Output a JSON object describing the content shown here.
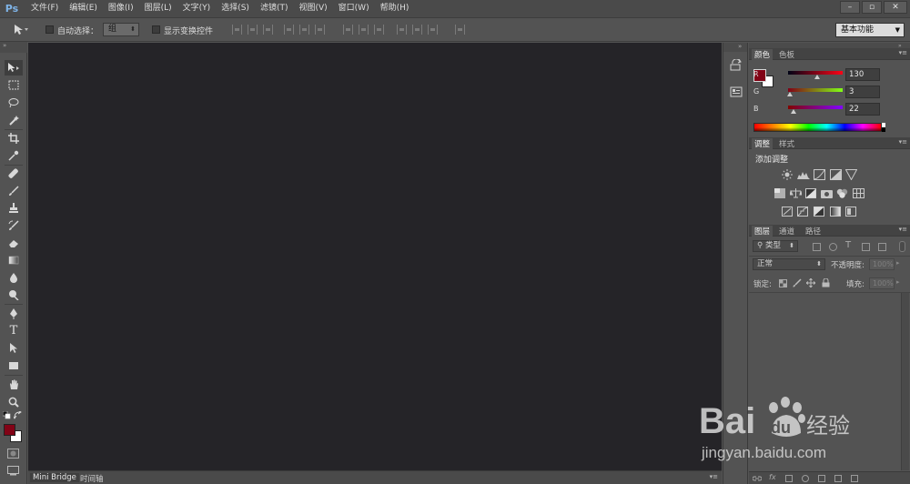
{
  "app": {
    "logo_text": "Ps",
    "menu": [
      "文件(F)",
      "编辑(E)",
      "图像(I)",
      "图层(L)",
      "文字(Y)",
      "选择(S)",
      "滤镜(T)",
      "视图(V)",
      "窗口(W)",
      "帮助(H)"
    ],
    "window_controls": [
      "–",
      "▫",
      "✕"
    ]
  },
  "options_bar": {
    "auto_select_label": "自动选择：",
    "auto_select_value": "组",
    "show_transform_label": "显示变换控件",
    "workspace": "基本功能"
  },
  "tools": [
    {
      "name": "move-tool",
      "icon": "move-icon"
    },
    {
      "name": "marquee-tool",
      "icon": "marquee-icon"
    },
    {
      "name": "lasso-tool",
      "icon": "lasso-icon"
    },
    {
      "name": "quick-select-tool",
      "icon": "wand-icon"
    },
    {
      "name": "crop-tool",
      "icon": "crop-icon"
    },
    {
      "name": "eyedropper-tool",
      "icon": "eyedropper-icon"
    },
    {
      "name": "healing-tool",
      "icon": "bandage-icon"
    },
    {
      "name": "brush-tool",
      "icon": "brush-icon"
    },
    {
      "name": "stamp-tool",
      "icon": "stamp-icon"
    },
    {
      "name": "history-brush-tool",
      "icon": "history-brush-icon"
    },
    {
      "name": "eraser-tool",
      "icon": "eraser-icon"
    },
    {
      "name": "gradient-tool",
      "icon": "gradient-icon"
    },
    {
      "name": "blur-tool",
      "icon": "drop-icon"
    },
    {
      "name": "dodge-tool",
      "icon": "dodge-icon"
    },
    {
      "name": "pen-tool",
      "icon": "pen-icon"
    },
    {
      "name": "type-tool",
      "icon": "type-icon"
    },
    {
      "name": "path-select-tool",
      "icon": "arrow-icon"
    },
    {
      "name": "shape-tool",
      "icon": "rectangle-icon"
    },
    {
      "name": "hand-tool",
      "icon": "hand-icon"
    },
    {
      "name": "zoom-tool",
      "icon": "zoom-icon"
    }
  ],
  "type_tool_glyph": "T",
  "colors": {
    "foreground": "#820316",
    "background": "#ffffff",
    "canvas": "#252428"
  },
  "bottom_tabs": [
    "Mini Bridge",
    "时间轴"
  ],
  "color_panel": {
    "tabs": [
      "颜色",
      "色板"
    ],
    "channels": [
      {
        "label": "R",
        "value": "130"
      },
      {
        "label": "G",
        "value": "3"
      },
      {
        "label": "B",
        "value": "22"
      }
    ]
  },
  "adjustments_panel": {
    "tabs": [
      "调整",
      "样式"
    ],
    "heading": "添加调整"
  },
  "layers_panel": {
    "tabs": [
      "图层",
      "通道",
      "路径"
    ],
    "filter_kind": "类型",
    "blend_mode": "正常",
    "opacity_label": "不透明度:",
    "opacity_value": "100%",
    "lock_label": "锁定:",
    "fill_label": "填充:",
    "fill_value": "100%"
  },
  "watermark": {
    "logo_text": "Bai",
    "logo_suffix": "经验",
    "url": "jingyan.baidu.com"
  }
}
